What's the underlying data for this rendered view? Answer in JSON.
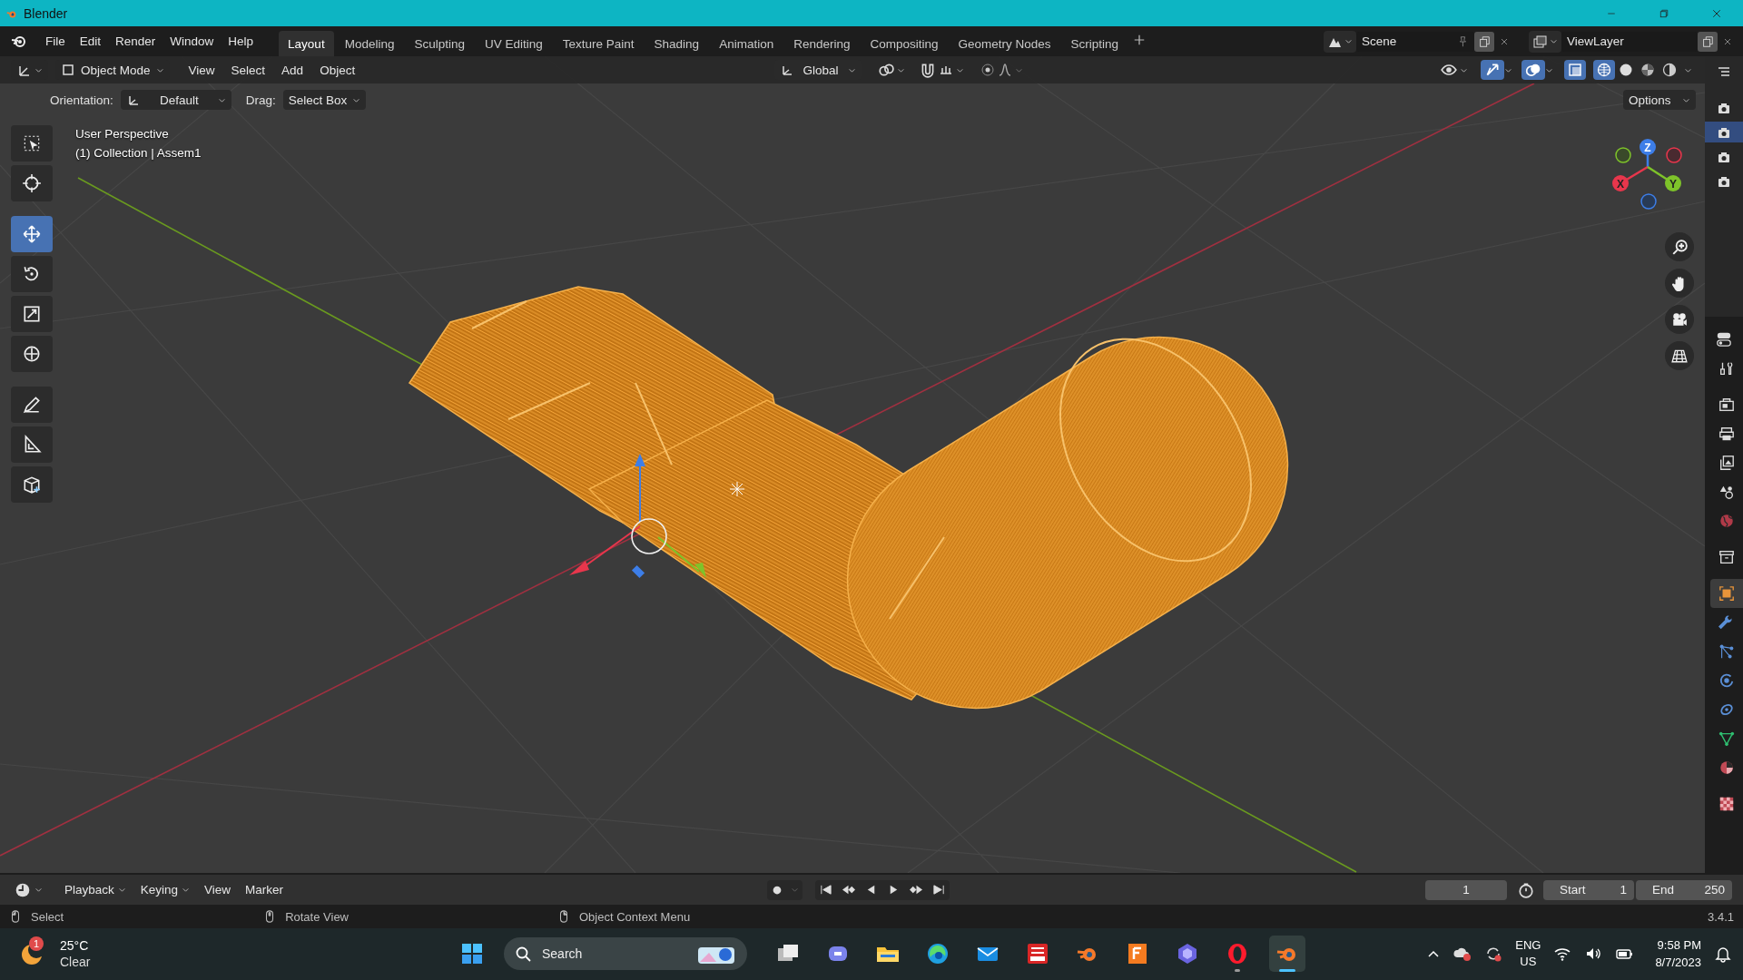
{
  "window": {
    "title": "Blender"
  },
  "menus": [
    "File",
    "Edit",
    "Render",
    "Window",
    "Help"
  ],
  "workspaces": [
    {
      "label": "Layout",
      "selected": true
    },
    {
      "label": "Modeling",
      "selected": false
    },
    {
      "label": "Sculpting",
      "selected": false
    },
    {
      "label": "UV Editing",
      "selected": false
    },
    {
      "label": "Texture Paint",
      "selected": false
    },
    {
      "label": "Shading",
      "selected": false
    },
    {
      "label": "Animation",
      "selected": false
    },
    {
      "label": "Rendering",
      "selected": false
    },
    {
      "label": "Compositing",
      "selected": false
    },
    {
      "label": "Geometry Nodes",
      "selected": false
    },
    {
      "label": "Scripting",
      "selected": false
    }
  ],
  "scene": {
    "name": "Scene"
  },
  "view_layer": {
    "name": "ViewLayer"
  },
  "viewport_header": {
    "mode": "Object Mode",
    "menus": [
      "View",
      "Select",
      "Add",
      "Object"
    ],
    "transform_orientation": "Global",
    "gizmos_on": true,
    "overlays_on": true,
    "xray_on": true,
    "shading": [
      {
        "kind": "wireframe",
        "selected": true
      },
      {
        "kind": "solid",
        "selected": false
      },
      {
        "kind": "material",
        "selected": false
      },
      {
        "kind": "rendered",
        "selected": false
      }
    ]
  },
  "tool_settings": {
    "orientation_label": "Orientation:",
    "orientation": "Default",
    "drag_label": "Drag:",
    "drag": "Select Box",
    "options": "Options"
  },
  "viewport": {
    "view_name": "User Perspective",
    "collection_info": "(1) Collection | Assem1",
    "gizmo_axes": [
      "X",
      "Y",
      "Z"
    ]
  },
  "tools": [
    {
      "kind": "select-box",
      "selected": false
    },
    {
      "kind": "cursor",
      "selected": false
    },
    {
      "kind": "move",
      "selected": true
    },
    {
      "kind": "rotate",
      "selected": false
    },
    {
      "kind": "scale",
      "selected": false
    },
    {
      "kind": "transform",
      "selected": false
    },
    {
      "kind": "annotate",
      "selected": false
    },
    {
      "kind": "measure",
      "selected": false
    },
    {
      "kind": "add-cube",
      "selected": false
    }
  ],
  "outliner_rows": [
    {
      "selected": false
    },
    {
      "selected": true
    },
    {
      "selected": false
    },
    {
      "selected": false
    }
  ],
  "properties_tabs": [
    {
      "kind": "tool",
      "selected": false
    },
    {
      "kind": "render",
      "selected": false
    },
    {
      "kind": "output",
      "selected": false
    },
    {
      "kind": "view-layer",
      "selected": false
    },
    {
      "kind": "scene",
      "selected": false
    },
    {
      "kind": "world",
      "selected": false
    },
    {
      "kind": "collection",
      "selected": false
    },
    {
      "kind": "object",
      "selected": true
    },
    {
      "kind": "modifiers",
      "selected": false
    },
    {
      "kind": "particles",
      "selected": false
    },
    {
      "kind": "physics",
      "selected": false
    },
    {
      "kind": "constraints",
      "selected": false
    },
    {
      "kind": "data",
      "selected": false
    },
    {
      "kind": "material",
      "selected": false
    },
    {
      "kind": "texture",
      "selected": false
    }
  ],
  "timeline": {
    "menus": [
      "Playback",
      "Keying",
      "View",
      "Marker"
    ],
    "current_frame": "1",
    "start_label": "Start",
    "start": "1",
    "end_label": "End",
    "end": "250"
  },
  "status_bar": {
    "hints": [
      "Select",
      "Rotate View",
      "Object Context Menu"
    ],
    "version": "3.4.1"
  },
  "taskbar": {
    "weather": {
      "badge": "1",
      "temperature": "25°C",
      "condition": "Clear"
    },
    "search_label": "Search",
    "apps": [
      {
        "kind": "task-view",
        "running": false,
        "selected": false
      },
      {
        "kind": "chat",
        "running": false,
        "selected": false
      },
      {
        "kind": "folder",
        "running": false,
        "selected": false
      },
      {
        "kind": "browser",
        "running": false,
        "selected": false
      },
      {
        "kind": "mail",
        "running": false,
        "selected": false
      },
      {
        "kind": "cad",
        "running": false,
        "selected": false
      },
      {
        "kind": "blender",
        "running": false,
        "selected": false
      },
      {
        "kind": "fusion",
        "running": false,
        "selected": false
      },
      {
        "kind": "hexagon",
        "running": false,
        "selected": false
      },
      {
        "kind": "opera",
        "running": true,
        "selected": false
      },
      {
        "kind": "blender",
        "running": true,
        "selected": true
      }
    ],
    "language": "ENG",
    "region": "US",
    "time": "9:58 PM",
    "date": "8/7/2023"
  }
}
